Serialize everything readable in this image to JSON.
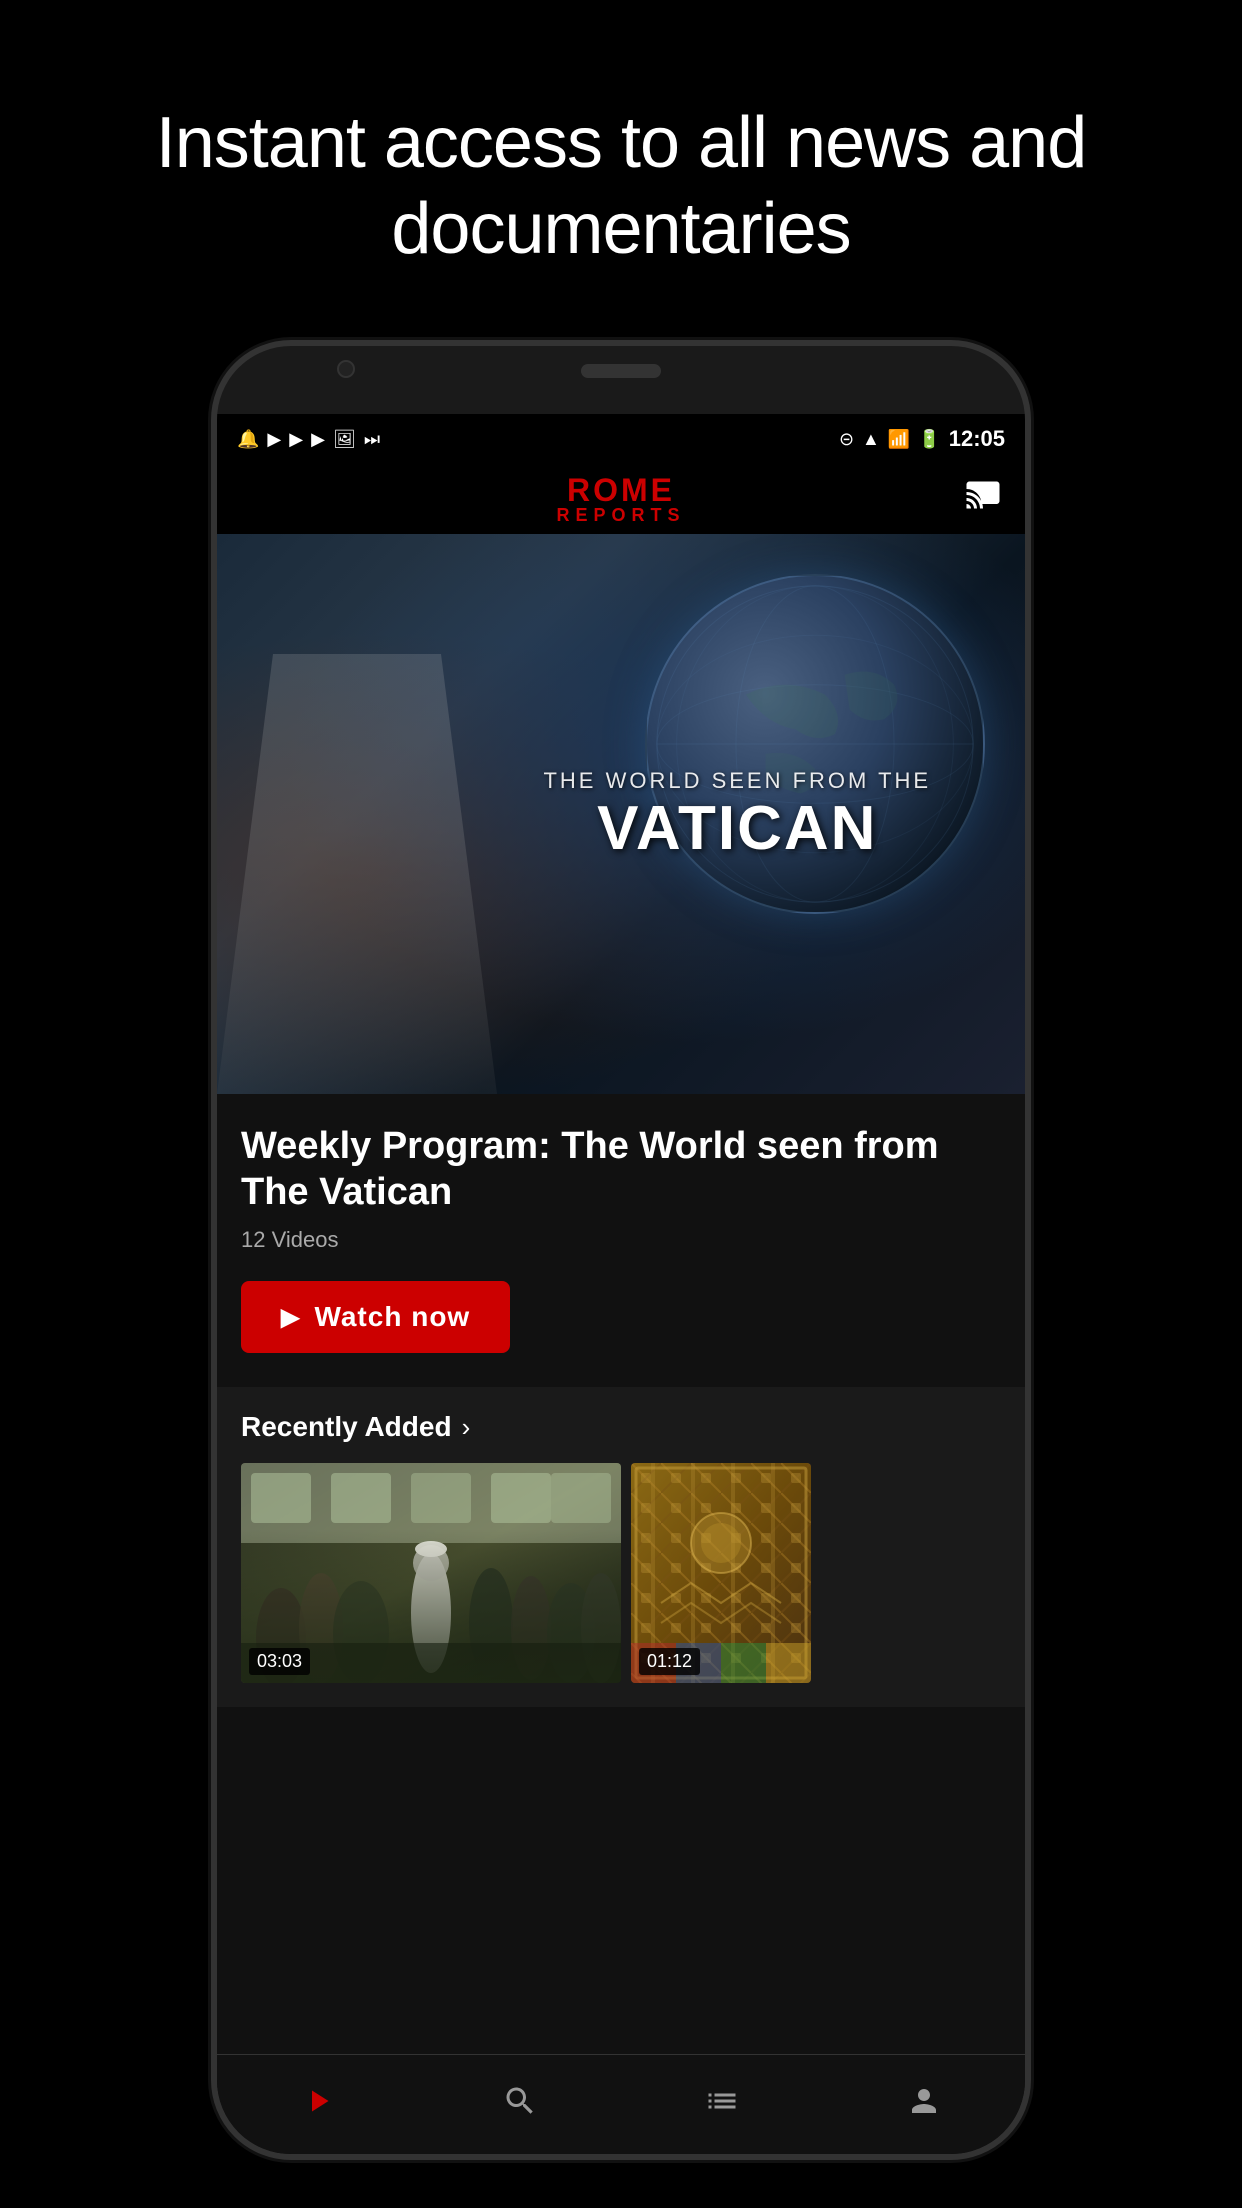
{
  "hero": {
    "title": "Instant access to all news and documentaries"
  },
  "status_bar": {
    "time": "12:05",
    "icons_left": [
      "notification",
      "play1",
      "play2",
      "play3",
      "image",
      "media"
    ],
    "icons_right": [
      "do-not-disturb",
      "wifi",
      "signal",
      "battery"
    ]
  },
  "app": {
    "logo_line1": "ROME",
    "logo_line2": "REPORTS"
  },
  "featured": {
    "banner_subtitle": "THE WORLD SEEN FROM THE",
    "banner_title": "VATICAN",
    "content_title": "Weekly Program: The World seen from The Vatican",
    "video_count": "12 Videos",
    "watch_button": "Watch now"
  },
  "recently_added": {
    "section_title": "Recently Added",
    "videos": [
      {
        "duration": "03:03"
      },
      {
        "duration": "01:12"
      }
    ]
  },
  "bottom_nav": {
    "items": [
      {
        "icon": "play",
        "label": ""
      },
      {
        "icon": "search",
        "label": ""
      },
      {
        "icon": "list",
        "label": ""
      },
      {
        "icon": "user",
        "label": ""
      }
    ]
  }
}
